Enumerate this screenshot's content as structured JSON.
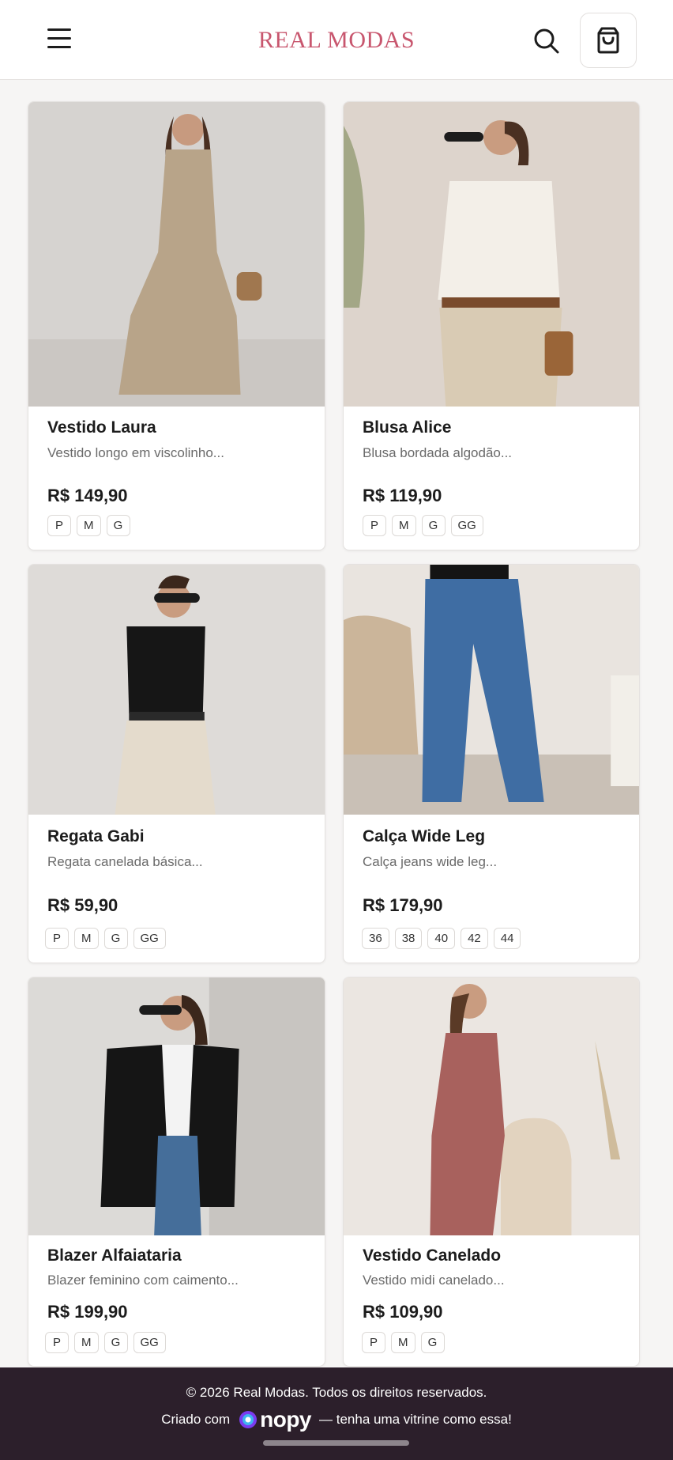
{
  "header": {
    "brand": "REAL MODAS",
    "menu_icon": "hamburger-menu-icon",
    "search_icon": "search-icon",
    "cart_icon": "shopping-bag-icon"
  },
  "products": [
    {
      "name": "Vestido Laura",
      "description": "Vestido longo em viscolinho...",
      "price": "R$ 149,90",
      "sizes": [
        "P",
        "M",
        "G"
      ]
    },
    {
      "name": "Blusa Alice",
      "description": "Blusa bordada algodão...",
      "price": "R$ 119,90",
      "sizes": [
        "P",
        "M",
        "G",
        "GG"
      ]
    },
    {
      "name": "Regata Gabi",
      "description": "Regata canelada básica...",
      "price": "R$ 59,90",
      "sizes": [
        "P",
        "M",
        "G",
        "GG"
      ]
    },
    {
      "name": "Calça Wide Leg",
      "description": "Calça jeans wide leg...",
      "price": "R$ 179,90",
      "sizes": [
        "36",
        "38",
        "40",
        "42",
        "44"
      ]
    },
    {
      "name": "Blazer Alfaiataria",
      "description": "Blazer feminino com caimento...",
      "price": "R$ 199,90",
      "sizes": [
        "P",
        "M",
        "G",
        "GG"
      ]
    },
    {
      "name": "Vestido Canelado",
      "description": "Vestido midi canelado...",
      "price": "R$ 109,90",
      "sizes": [
        "P",
        "M",
        "G"
      ]
    }
  ],
  "footer": {
    "copyright": "© 2026 Real Modas. Todos os direitos reservados.",
    "created_with": "Criado com",
    "logo_text": "nopy",
    "tagline": "— tenha uma vitrine como essa!"
  },
  "colors": {
    "brand": "#c8566e",
    "footer_bg": "#2c1f2b",
    "page_bg": "#f6f5f4"
  }
}
